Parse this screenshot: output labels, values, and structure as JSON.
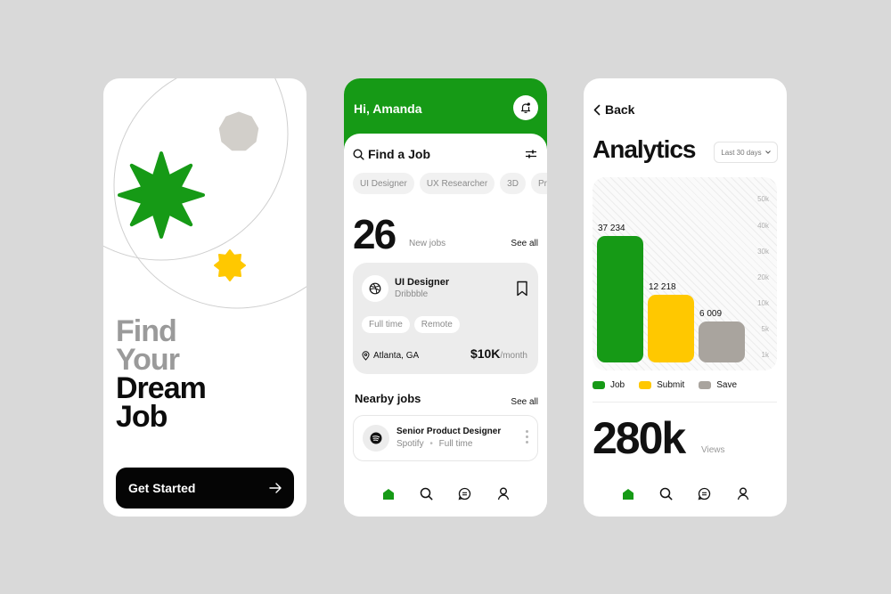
{
  "onboarding": {
    "headline_gray": [
      "Find",
      "Your"
    ],
    "headline_dark": [
      "Dream",
      "Job"
    ],
    "cta_label": "Get Started",
    "colors": {
      "green": "#169a16",
      "yellow": "#ffc800",
      "gray": "#d2cfca"
    }
  },
  "home": {
    "greeting": "Hi, Amanda",
    "search_label": "Find a Job",
    "chips": [
      "UI Designer",
      "UX Researcher",
      "3D",
      "Pro"
    ],
    "new_jobs_count": "26",
    "new_jobs_label": "New jobs",
    "see_all": "See all",
    "featured_job": {
      "title": "UI Designer",
      "company": "Dribbble",
      "tags": [
        "Full time",
        "Remote"
      ],
      "location": "Atlanta, GA",
      "salary": "$10K",
      "salary_period": "/month"
    },
    "nearby_title": "Nearby jobs",
    "nearby_see_all": "See all",
    "nearby_job": {
      "title": "Senior Product Designer",
      "company": "Spotify",
      "type": "Full time"
    },
    "accent": "#169a16"
  },
  "analytics": {
    "back_label": "Back",
    "title": "Analytics",
    "range": "Last 30 days",
    "views_value": "280k",
    "views_label": "Views"
  },
  "chart_data": {
    "type": "bar",
    "categories": [
      "Job",
      "Submit",
      "Save"
    ],
    "values": [
      37234,
      12218,
      6009
    ],
    "value_labels": [
      "37 234",
      "12 218",
      "6 009"
    ],
    "colors": [
      "#169a16",
      "#ffc800",
      "#a9a49e"
    ],
    "y_ticks": [
      "1k",
      "5k",
      "10k",
      "20k",
      "30k",
      "40k",
      "50k"
    ],
    "y_tick_values": [
      1000,
      5000,
      10000,
      20000,
      30000,
      40000,
      50000
    ],
    "legend": [
      "Job",
      "Submit",
      "Save"
    ],
    "legend_position": "bottom",
    "title": "",
    "xlabel": "",
    "ylabel": ""
  }
}
